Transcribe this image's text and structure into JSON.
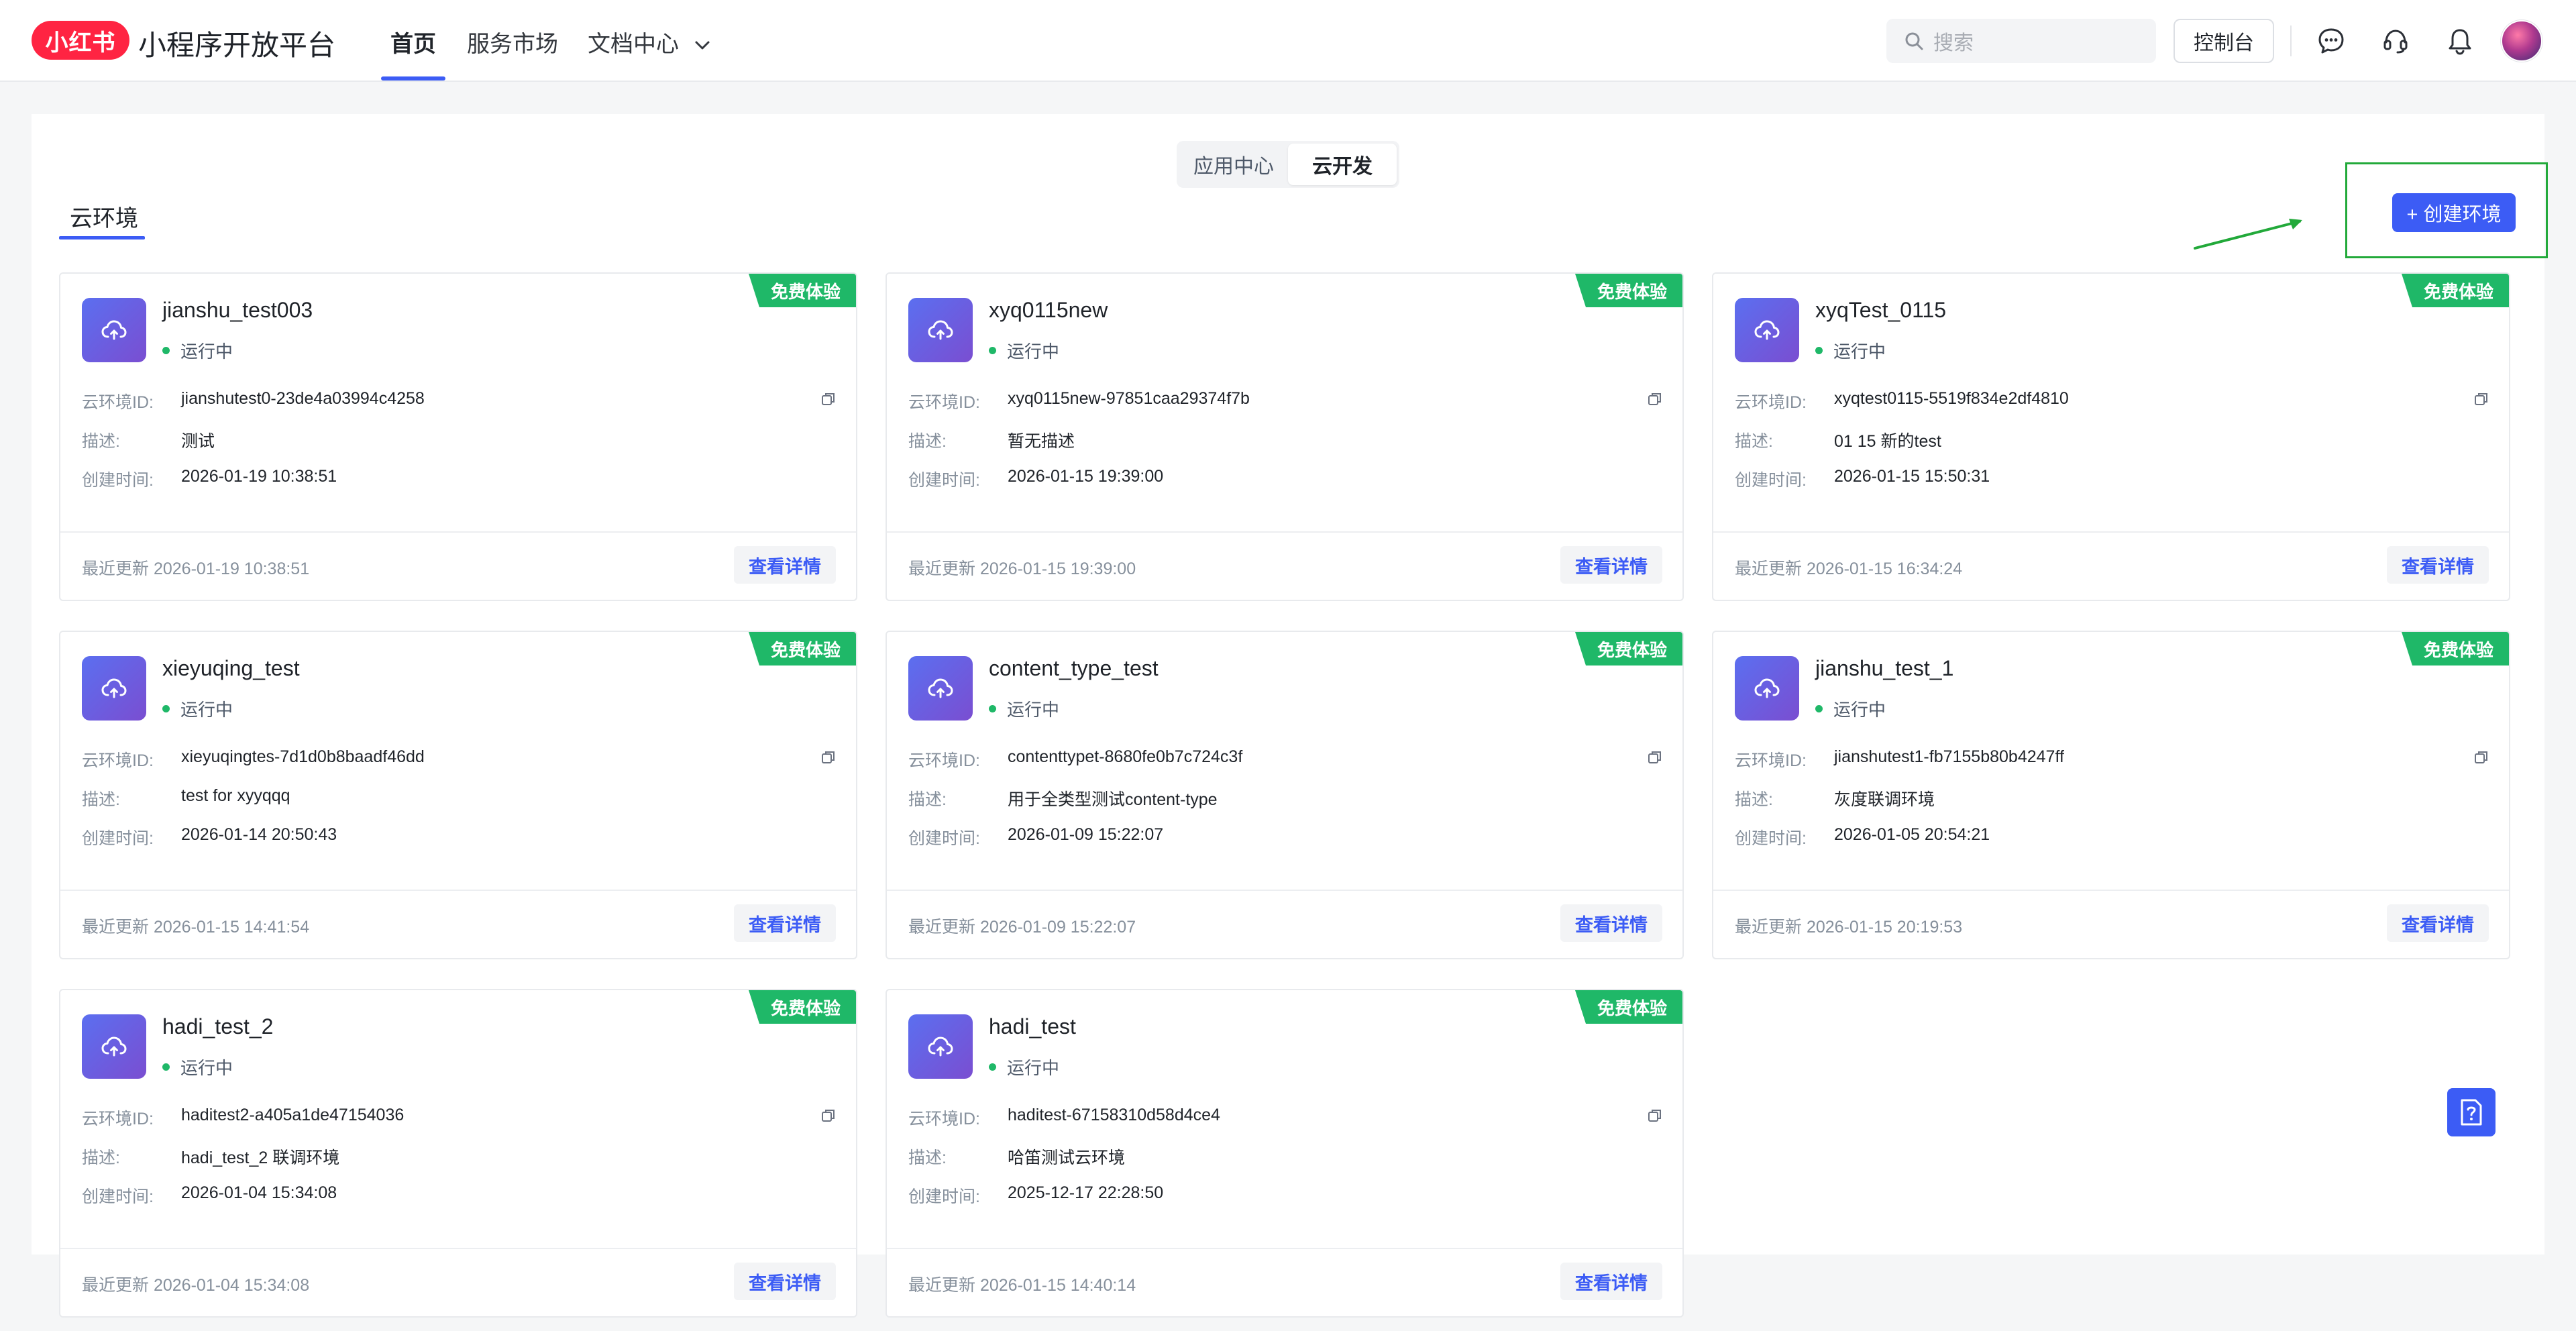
{
  "header": {
    "logo_text": "小红书",
    "platform_title": "小程序开放平台",
    "nav_tabs": [
      {
        "label": "首页",
        "active": true
      },
      {
        "label": "服务市场",
        "active": false
      },
      {
        "label": "文档中心",
        "active": false
      }
    ],
    "search_placeholder": "搜索",
    "console_label": "控制台",
    "icons": [
      "message-icon",
      "headset-icon",
      "bell-icon"
    ]
  },
  "segmented": {
    "items": [
      {
        "label": "应用中心",
        "active": false
      },
      {
        "label": "云开发",
        "active": true
      }
    ]
  },
  "section_tab": "云环境",
  "create_button": "+ 创建环境",
  "labels": {
    "env_id": "云环境ID:",
    "desc": "描述:",
    "created": "创建时间:",
    "status": "运行中",
    "free_tag": "免费体验",
    "detail": "查看详情",
    "updated_prefix": "最近更新"
  },
  "environments": [
    {
      "name": "jianshu_test003",
      "env_id": "jianshutest0-23de4a03994c4258",
      "desc": "测试",
      "created": "2026-01-19 10:38:51",
      "updated": "2026-01-19 10:38:51"
    },
    {
      "name": "xyq0115new",
      "env_id": "xyq0115new-97851caa29374f7b",
      "desc": "暂无描述",
      "created": "2026-01-15 19:39:00",
      "updated": "2026-01-15 19:39:00"
    },
    {
      "name": "xyqTest_0115",
      "env_id": "xyqtest0115-5519f834e2df4810",
      "desc": "01 15 新的test",
      "created": "2026-01-15 15:50:31",
      "updated": "2026-01-15 16:34:24"
    },
    {
      "name": "xieyuqing_test",
      "env_id": "xieyuqingtes-7d1d0b8baadf46dd",
      "desc": "test for xyyqqq",
      "created": "2026-01-14 20:50:43",
      "updated": "2026-01-15 14:41:54"
    },
    {
      "name": "content_type_test",
      "env_id": "contenttypet-8680fe0b7c724c3f",
      "desc": "用于全类型测试content-type",
      "created": "2026-01-09 15:22:07",
      "updated": "2026-01-09 15:22:07"
    },
    {
      "name": "jianshu_test_1",
      "env_id": "jianshutest1-fb7155b80b4247ff",
      "desc": "灰度联调环境",
      "created": "2026-01-05 20:54:21",
      "updated": "2026-01-15 20:19:53"
    },
    {
      "name": "hadi_test_2",
      "env_id": "haditest2-a405a1de47154036",
      "desc": "hadi_test_2 联调环境",
      "created": "2026-01-04 15:34:08",
      "updated": "2026-01-04 15:34:08"
    },
    {
      "name": "hadi_test",
      "env_id": "haditest-67158310d58d4ce4",
      "desc": "哈笛测试云环境",
      "created": "2025-12-17 22:28:50",
      "updated": "2026-01-15 14:40:14"
    }
  ],
  "colors": {
    "accent": "#3c5cf5",
    "free_tag": "#1fb868",
    "brand_red": "#ff2442",
    "annotation_green": "#22a93a"
  }
}
